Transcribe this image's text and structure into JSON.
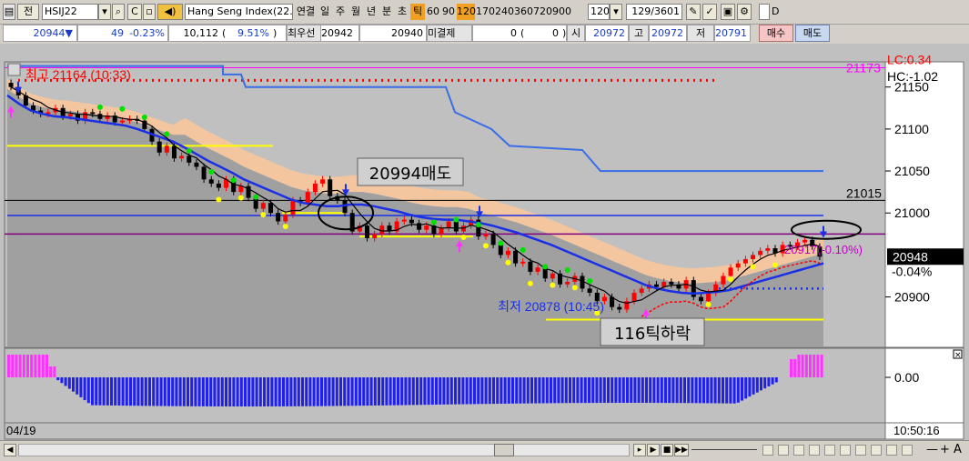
{
  "toolbar": {
    "order_label": "전",
    "symbol": "HSIJ22",
    "product_name": "Hang Seng Index(22.0",
    "periods": [
      "연결",
      "일",
      "주",
      "월",
      "년",
      "분",
      "초",
      "틱",
      "60",
      "90",
      "120",
      "170",
      "240",
      "360",
      "720",
      "900"
    ],
    "active_periods": [
      "틱",
      "120"
    ],
    "tick_unit": "120",
    "count_display": "129",
    "count_total": "/3601",
    "d_label": "D"
  },
  "quote": {
    "price": "20944",
    "change_arrow": "▼",
    "change": "49",
    "change_pct": "-0.23%",
    "volume": "10,112",
    "volume_ratio": "9.51%",
    "best_ask_label": "최우선",
    "best_ask": "20942",
    "best_bid": "20940",
    "open_interest_label": "미결제",
    "open_interest": "0",
    "oi_change": "0",
    "open_label": "시",
    "open": "20972",
    "high_label": "고",
    "high": "20972",
    "low_label": "저",
    "low": "20791",
    "buy_button": "매수",
    "sell_button": "매도"
  },
  "chart": {
    "high_annotation": "최고 21164 (10:33)",
    "low_annotation": "최저 20878 (10:45)",
    "sell_box": "20994매도",
    "drop_box": "116틱하락",
    "signal_annotation": "20917(-0.10%)",
    "lc_label": "LC:0.34",
    "hc_label": "HC:-1.02",
    "level_magenta": "21173",
    "level_line": "21015",
    "current_price_tag": "20948",
    "current_pct": "-0.04%",
    "y_ticks": [
      "21150",
      "21100",
      "21050",
      "21000",
      "20900"
    ],
    "osc_tick": "0.00",
    "date_label": "04/19",
    "time_label": "10:50:16",
    "colors": {
      "background": "#c0c0c0",
      "cloud_outer": "#f3c6a0",
      "cloud_inner": "#9a9a9a",
      "ma_blue": "#1a2fe6",
      "envelope": "#3a6ee6",
      "band_yellow": "#ffff00",
      "high_dots": "#ff0000",
      "osc_positive": "#ff33ff",
      "osc_negative": "#2020ee"
    }
  },
  "chart_data": {
    "type": "candlestick",
    "ylim": [
      20840,
      21180
    ],
    "closes": [
      21150,
      21140,
      21128,
      21122,
      21118,
      21120,
      21125,
      21115,
      21118,
      21110,
      21120,
      21118,
      21112,
      21116,
      21108,
      21110,
      21112,
      21110,
      21100,
      21085,
      21072,
      21080,
      21065,
      21068,
      21060,
      21055,
      21040,
      21035,
      21030,
      21040,
      21025,
      21032,
      21018,
      21005,
      21012,
      21000,
      20990,
      20998,
      21015,
      21012,
      21025,
      21035,
      21040,
      21020,
      21015,
      21000,
      20978,
      20985,
      20970,
      20975,
      20985,
      20978,
      20990,
      20992,
      20988,
      20980,
      20985,
      20975,
      20982,
      20990,
      20978,
      20985,
      20992,
      20972,
      20975,
      20962,
      20950,
      20955,
      20940,
      20942,
      20930,
      20935,
      20922,
      20928,
      20915,
      20918,
      20925,
      20910,
      20905,
      20895,
      20900,
      20888,
      20885,
      20895,
      20905,
      20910,
      20915,
      20912,
      20918,
      20915,
      20910,
      20920,
      20900,
      20895,
      20905,
      20915,
      20925,
      20935,
      20940,
      20945,
      20950,
      20955,
      20958,
      20952,
      20962,
      20960,
      20965,
      20968,
      20960,
      20948
    ],
    "series": [
      {
        "name": "MA",
        "values": [
          21140,
          21130,
          21122,
          21118,
          21115,
          21114,
          21112,
          21110,
          21108,
          21106,
          21104,
          21100,
          21095,
          21090,
          21085,
          21078,
          21070,
          21062,
          21055,
          21048,
          21040,
          21034,
          21028,
          21022,
          21016,
          21012,
          21010,
          21008,
          21008,
          21010,
          21010,
          21008,
          21005,
          21002,
          20998,
          20995,
          20993,
          20992,
          20992,
          20990,
          20988,
          20985,
          20981,
          20977,
          20972,
          20967,
          20962,
          20956,
          20950,
          20944,
          20938,
          20932,
          20926,
          20920,
          20914,
          20910,
          20907,
          20905,
          20904,
          20905,
          20906,
          20908,
          20912,
          20916,
          20920,
          20924,
          20928,
          20932,
          20936,
          20940
        ]
      }
    ],
    "oscillator": {
      "positive_start": [
        4,
        2
      ],
      "negative": 63,
      "positive_end": 5
    }
  },
  "bottom": {
    "nav_buttons": [
      "▸",
      "▶",
      "■",
      "▶▶"
    ],
    "right_tools": [
      "—",
      "+",
      "A"
    ]
  }
}
